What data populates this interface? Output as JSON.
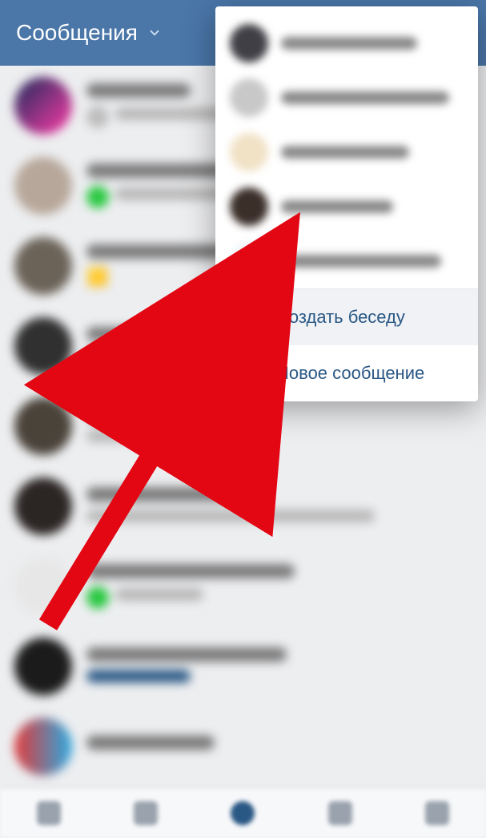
{
  "header": {
    "title": "Сообщения"
  },
  "dropdown": {
    "contacts": [
      {
        "avatar": "#3f3f45",
        "nameW": 170
      },
      {
        "avatar": "#c8c8c8",
        "nameW": 210
      },
      {
        "avatar": "#f1e2c6",
        "nameW": 160
      },
      {
        "avatar": "#3b2f2a",
        "nameW": 140
      },
      {
        "avatar": "#eef6fa",
        "nameW": 200
      }
    ],
    "actions": {
      "create_chat": "Создать беседу",
      "new_message": "Новое сообщение"
    }
  },
  "chats": [
    {
      "avatar": "linear-gradient(135deg,#1b2a5a,#ff3ba7)",
      "t1w": 130,
      "sub": {
        "mini": "#bdbdbd",
        "t2w": 190
      }
    },
    {
      "avatar": "#b7a79a",
      "t1w": 210,
      "sub": {
        "mini": "#28c840",
        "t2w": 150
      }
    },
    {
      "avatar": "#6b6358",
      "t1w": 200,
      "sub": {
        "emoji": "🟨",
        "t2w": 0
      }
    },
    {
      "avatar": "#303030",
      "t1w": 230,
      "sub": {
        "link": true,
        "t2w": 130
      }
    },
    {
      "avatar": "#4a433a",
      "t1w": 170,
      "sub": {
        "t2w": 120
      }
    },
    {
      "avatar": "#2b2524",
      "t1w": 200,
      "sub": {
        "t2w": 360
      }
    },
    {
      "avatar": "#e7e7e7",
      "t1w": 260,
      "sub": {
        "mini": "#28c840",
        "t2w": 110
      }
    },
    {
      "avatar": "#1b1b1b",
      "t1w": 250,
      "sub": {
        "link": true,
        "t2w": 130
      }
    },
    {
      "avatar": "linear-gradient(90deg,#e03a3a,#2aa8e0)",
      "t1w": 160,
      "sub": {
        "t2w": 0
      }
    }
  ],
  "arrow": {
    "color": "#e30613"
  }
}
